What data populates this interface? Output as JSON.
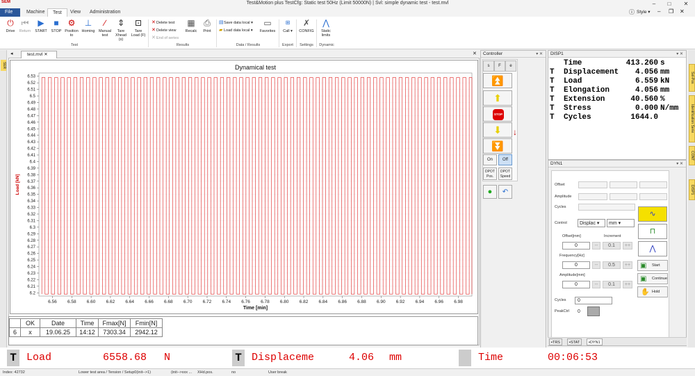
{
  "window": {
    "title": "Test&Motion plus   TestCfg: Static test 50Hz (Limit 50000N) | Svl: simple dynamic test  - test.mvl",
    "style_label": "Style",
    "logo_text": "SEM"
  },
  "menu": {
    "tabs": [
      "File",
      "Machine",
      "Test",
      "View",
      "Administration"
    ],
    "active": "Test"
  },
  "ribbon": {
    "test_group": {
      "label": "Test",
      "buttons": [
        {
          "label": "Drive",
          "icon": "power-icon"
        },
        {
          "label": "Return",
          "icon": "return-icon"
        },
        {
          "label": "START",
          "icon": "play-icon"
        },
        {
          "label": "STOP",
          "icon": "stop-icon"
        },
        {
          "label": "Position to",
          "icon": "position-icon"
        },
        {
          "label": "Homing",
          "icon": "homing-icon"
        },
        {
          "label": "Manual test",
          "icon": "manual-test-icon"
        },
        {
          "label": "Tare Xhead (s)",
          "icon": "tare-xhead-icon"
        },
        {
          "label": "Tare Load (F)",
          "icon": "tare-load-icon"
        }
      ]
    },
    "results_group": {
      "label": "Results",
      "small_buttons": [
        "Delete test",
        "Delete view",
        "End of series"
      ],
      "buttons": [
        {
          "label": "Recalc",
          "icon": "recalc-icon"
        },
        {
          "label": "Print",
          "icon": "print-icon"
        }
      ]
    },
    "data_group": {
      "label": "Data / Results",
      "small_buttons": [
        "Save data local",
        "Load data local"
      ],
      "buttons": [
        {
          "label": "Favorites",
          "icon": "favorites-icon"
        }
      ]
    },
    "export_group": {
      "label": "Export",
      "buttons": [
        {
          "label": "Call",
          "icon": "call-icon"
        }
      ]
    },
    "settings_group": {
      "label": "Settings",
      "buttons": [
        {
          "label": "CONFIG",
          "icon": "config-icon"
        }
      ]
    },
    "dynamic_group": {
      "label": "Dynamic",
      "buttons": [
        {
          "label": "Static limits",
          "icon": "static-limits-icon"
        }
      ]
    }
  },
  "left_panel_tab": "SER",
  "document": {
    "tab": "test.mvl"
  },
  "chart_data": {
    "type": "line",
    "title": "Dynamical test",
    "xlabel": "Time [min]",
    "ylabel": "Load [kN]",
    "xlim": [
      6.546,
      6.994
    ],
    "ylim": [
      6.195,
      6.535
    ],
    "x_ticks": [
      6.56,
      6.58,
      6.6,
      6.62,
      6.64,
      6.66,
      6.68,
      6.7,
      6.72,
      6.74,
      6.76,
      6.78,
      6.8,
      6.82,
      6.84,
      6.86,
      6.88,
      6.9,
      6.92,
      6.94,
      6.96,
      6.98
    ],
    "y_ticks": [
      6.2,
      6.21,
      6.22,
      6.23,
      6.24,
      6.25,
      6.26,
      6.27,
      6.28,
      6.29,
      6.3,
      6.31,
      6.32,
      6.33,
      6.34,
      6.35,
      6.36,
      6.37,
      6.38,
      6.39,
      6.4,
      6.41,
      6.42,
      6.43,
      6.44,
      6.45,
      6.46,
      6.47,
      6.48,
      6.49,
      6.5,
      6.51,
      6.52,
      6.53
    ],
    "grid": true,
    "series": [
      {
        "color": "#e02020",
        "description": "square wave oscillating between ~6.198 and ~6.528 kN",
        "period_min": 0.0066,
        "start_x": 6.549,
        "low": 6.198,
        "high": 6.528
      }
    ]
  },
  "results_table": {
    "columns": [
      "",
      "OK",
      "Date",
      "Time",
      "Fmax[N]",
      "Fmin[N]"
    ],
    "rows": [
      [
        "6",
        "x",
        "19.06.25",
        "14:12",
        "7303.34",
        "2942.12"
      ]
    ]
  },
  "controller": {
    "title": "Controller",
    "mode_buttons": [
      "s",
      "F",
      "e"
    ],
    "stop_label": "STOP",
    "on_label": "On",
    "off_label": "Off",
    "dpot_pos": "DPOT Pos.",
    "dpot_speed": "DPOT Speed"
  },
  "disp1": {
    "title": "DISP1",
    "rows": [
      {
        "t": "",
        "label": "Time",
        "value": "413.260",
        "unit": "s"
      },
      {
        "t": "T",
        "label": "Displacement",
        "value": "4.056",
        "unit": "mm"
      },
      {
        "t": "T",
        "label": "Load",
        "value": "6.559",
        "unit": "kN"
      },
      {
        "t": "T",
        "label": "Elongation",
        "value": "4.056",
        "unit": "mm"
      },
      {
        "t": "T",
        "label": "Extension",
        "value": "40.560",
        "unit": "%"
      },
      {
        "t": "T",
        "label": "Stress",
        "value": "0.000",
        "unit": "N/mm"
      },
      {
        "t": "T",
        "label": "Cycles",
        "value": "1644.0",
        "unit": ""
      }
    ]
  },
  "dyn1": {
    "title": "DYN1",
    "offset_label": "Offset",
    "amplitude_label": "Amplitude",
    "cycles_label": "Cycles",
    "control_label": "Control",
    "control_value": "Displac",
    "control_unit": "mm",
    "offset_mm_label": "Offset[mm]",
    "increment_label": "Increment",
    "offset_value": "0",
    "offset_inc": "0.1",
    "frequency_label": "Frequency[Hz]",
    "frequency_value": "0",
    "frequency_inc": "0.5",
    "amplitude_mm_label": "Amplitude[mm]",
    "amplitude_value": "0",
    "amplitude_inc": "0.1",
    "minus_label": "--",
    "plus_label": "++",
    "start_label": "Start",
    "continue_label": "Continue",
    "hold_label": "Hold",
    "cycles_value": "0",
    "peakctrl_label": "PeakCtrl",
    "peakctrl_value": "0"
  },
  "right_tabs": [
    "Sel-Pos",
    "Identification Serie",
    "CONT",
    "DISP1"
  ],
  "bottom_tabs": [
    "TRS",
    "STAT",
    "DYN1"
  ],
  "bigbar": [
    {
      "label": "Load",
      "value": "6558.68",
      "unit": "N"
    },
    {
      "label": "Displaceme",
      "value": "4.06",
      "unit": "mm"
    },
    {
      "label": "Time",
      "value": "00:06:53",
      "unit": ""
    }
  ],
  "statusbar": {
    "index": "Index: 42732",
    "area": "Lower test area / Tension / Setup0(init-->1)",
    "init": "(init-->xxx ...",
    "xhd": "XHd.pos.",
    "no": "no",
    "user": "User break"
  },
  "colors": {
    "accent": "#2b579a",
    "curve": "#e02020",
    "bigbar_text": "#dd0000",
    "highlight": "#f5e000"
  }
}
